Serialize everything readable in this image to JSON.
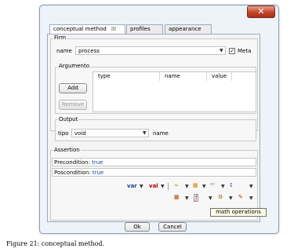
{
  "window": {
    "close_glyph": "✕"
  },
  "tabs": [
    {
      "label": "conceptual method",
      "close_glyph": "☒"
    },
    {
      "label": "profiles"
    },
    {
      "label": "appearance"
    }
  ],
  "firm": {
    "legend": "Firm",
    "name_label": "name",
    "name_value": "process",
    "meta_label": "Meta",
    "meta_checked": "✓"
  },
  "argumento": {
    "legend": "Argumento",
    "add_label": "Add",
    "remove_label": "Remove",
    "columns": [
      "type",
      "name",
      "value"
    ]
  },
  "output": {
    "legend": "Output",
    "tipo_label": "tipo",
    "tipo_value": "void",
    "name_label": "name"
  },
  "assertion": {
    "legend": "Assertion",
    "precondition_label": "Precondition:",
    "precondition_value": "true",
    "poscondition_label": "Poscondition:",
    "poscondition_value": "true"
  },
  "toolbar": {
    "var_label": "var",
    "val_label": "val",
    "icons": [
      "infinity-icon",
      "table-icon",
      "binary-icon",
      "sort-icon",
      "grid-icon",
      "function-icon",
      "gear-icon",
      "edit-icon"
    ]
  },
  "tooltip": "math operations",
  "footer": {
    "ok_label": "Ok",
    "cancel_label": "Cancel"
  },
  "caption": "Figure 21: conceptual method.",
  "colors": {
    "accent": "#1f3fa0",
    "close": "#c3442a"
  }
}
